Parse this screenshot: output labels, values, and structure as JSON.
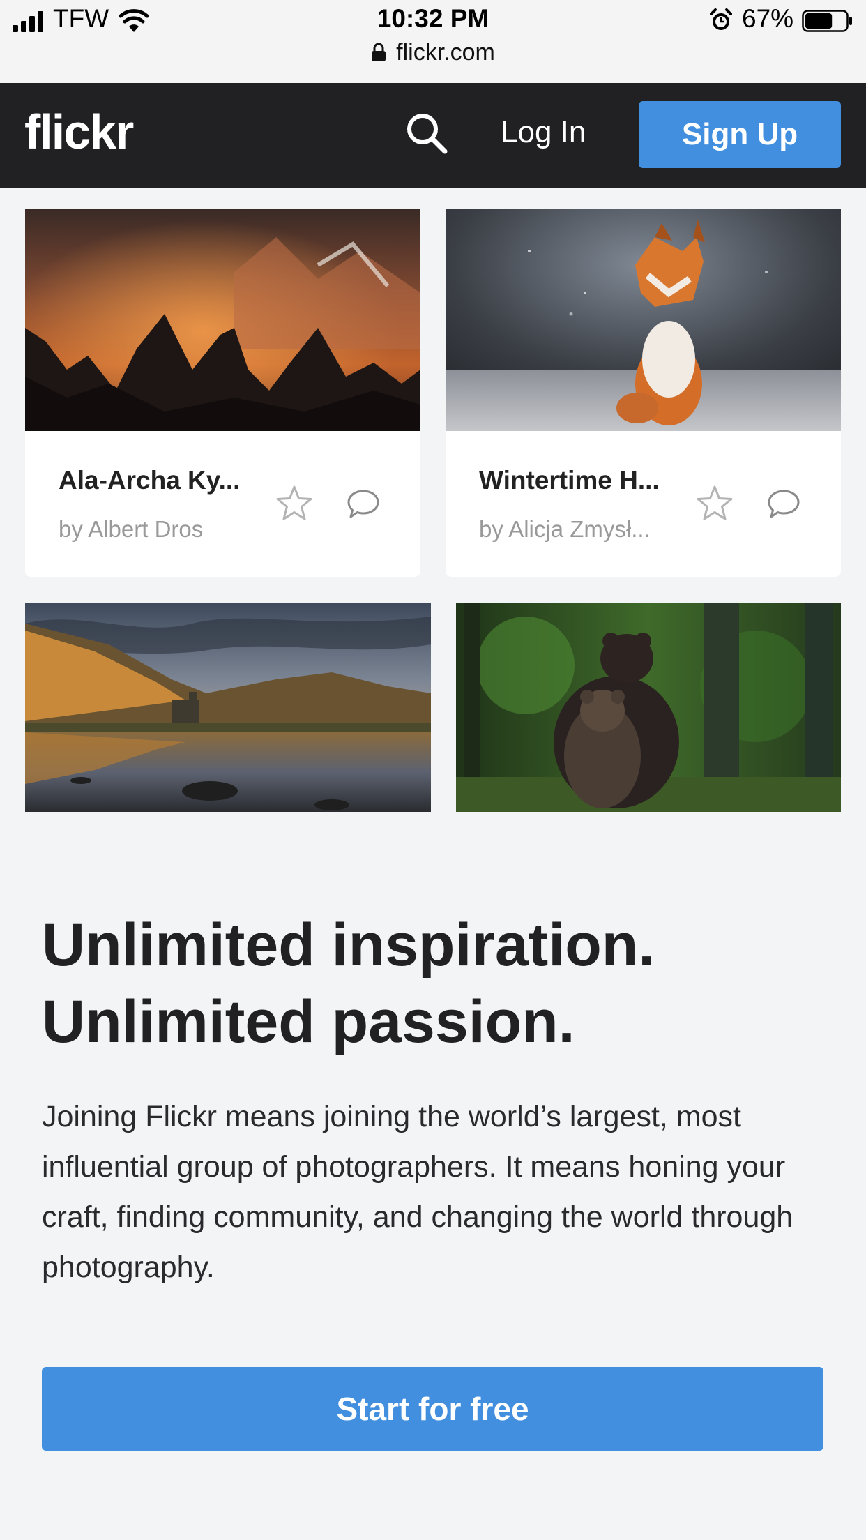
{
  "status_bar": {
    "carrier": "TFW",
    "time": "10:32 PM",
    "battery_percent": "67%",
    "battery_level": 0.67,
    "icons": [
      "signal-icon",
      "wifi-icon",
      "alarm-icon",
      "battery-icon"
    ]
  },
  "browser": {
    "url": "flickr.com",
    "icon": "lock-icon"
  },
  "header": {
    "logo": "flickr",
    "search_icon": "search-icon",
    "login_label": "Log In",
    "signup_label": "Sign Up",
    "accent_color": "#418fde",
    "background_color": "#212124"
  },
  "photos": [
    {
      "title": "Ala-Archa Ky...",
      "author": "by Albert Dros",
      "subject": "mountain-landscape",
      "icons": [
        "star-icon",
        "comment-icon"
      ]
    },
    {
      "title": "Wintertime H...",
      "author": "by Alicja Zmysł...",
      "subject": "fox",
      "icons": [
        "star-icon",
        "comment-icon"
      ]
    },
    {
      "subject": "castle-lake-reflection"
    },
    {
      "subject": "bears-in-forest"
    }
  ],
  "promo": {
    "headline_line1": "Unlimited inspiration.",
    "headline_line2": "Unlimited passion.",
    "body": "Joining Flickr means joining the world’s largest, most influential group of photographers. It means honing your craft, finding community, and changing the world through photography.",
    "cta_label": "Start for free"
  }
}
